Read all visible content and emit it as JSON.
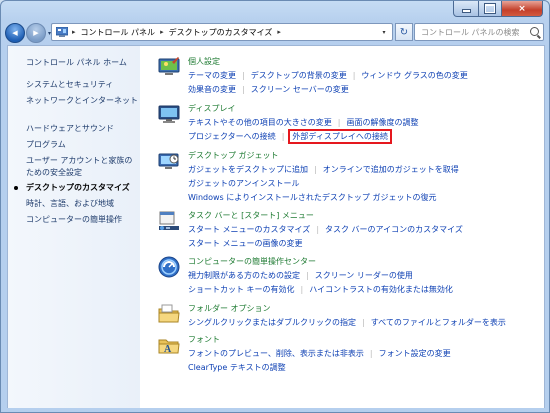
{
  "titlebar": {
    "minimize": "",
    "maximize": "",
    "close": "×"
  },
  "nav": {
    "back": "◀",
    "forward": "▶",
    "dropdown": "▾"
  },
  "address": {
    "crumbs": [
      "コントロール パネル",
      "デスクトップのカスタマイズ"
    ],
    "refresh": "↻"
  },
  "search": {
    "placeholder": "コントロール パネルの検索"
  },
  "sidebar": {
    "items": [
      {
        "label": "コントロール パネル ホーム"
      },
      {
        "label": "システムとセキュリティ"
      },
      {
        "label": "ネットワークとインターネット"
      },
      {
        "label": "ハードウェアとサウンド"
      },
      {
        "label": "プログラム"
      },
      {
        "label": "ユーザー アカウントと家族の"
      },
      {
        "label": "ための安全設定"
      },
      {
        "label": "デスクトップのカスタマイズ"
      },
      {
        "label": "時計、言語、および地域"
      },
      {
        "label": "コンピューターの簡単操作"
      }
    ]
  },
  "categories": [
    {
      "title": "個人設定",
      "icon": "personalization-icon",
      "rows": [
        [
          "テーマの変更",
          "デスクトップの背景の変更",
          "ウィンドウ グラスの色の変更"
        ],
        [
          "効果音の変更",
          "スクリーン セーバーの変更"
        ]
      ]
    },
    {
      "title": "ディスプレイ",
      "icon": "display-icon",
      "rows": [
        [
          "テキストやその他の項目の大きさの変更",
          "画面の解像度の調整"
        ],
        [
          "プロジェクターへの接続",
          "外部ディスプレイへの接続"
        ]
      ]
    },
    {
      "title": "デスクトップ ガジェット",
      "icon": "gadgets-icon",
      "rows": [
        [
          "ガジェットをデスクトップに追加",
          "オンラインで追加のガジェットを取得"
        ],
        [
          "ガジェットのアンインストール"
        ],
        [
          "Windows によりインストールされたデスクトップ ガジェットの復元"
        ]
      ]
    },
    {
      "title": "タスク バーと [スタート] メニュー",
      "icon": "taskbar-icon",
      "rows": [
        [
          "スタート メニューのカスタマイズ",
          "タスク バーのアイコンのカスタマイズ"
        ],
        [
          "スタート メニューの画像の変更"
        ]
      ]
    },
    {
      "title": "コンピューターの簡単操作センター",
      "icon": "ease-of-access-icon",
      "rows": [
        [
          "視力制限がある方のための設定",
          "スクリーン リーダーの使用"
        ],
        [
          "ショートカット キーの有効化",
          "ハイコントラストの有効化または無効化"
        ]
      ]
    },
    {
      "title": "フォルダー オプション",
      "icon": "folder-options-icon",
      "rows": [
        [
          "シングルクリックまたはダブルクリックの指定",
          "すべてのファイルとフォルダーを表示"
        ]
      ]
    },
    {
      "title": "フォント",
      "icon": "fonts-icon",
      "rows": [
        [
          "フォントのプレビュー、削除、表示または非表示",
          "フォント設定の変更"
        ],
        [
          "ClearType テキストの調整"
        ]
      ]
    }
  ],
  "colors": {
    "link": "#0c3fb3",
    "category_title": "#1d7a31",
    "highlight": "#e5181e"
  }
}
